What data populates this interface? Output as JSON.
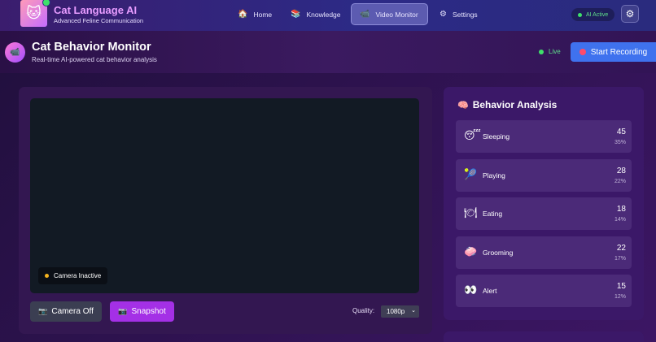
{
  "app": {
    "title": "Cat Language AI",
    "subtitle": "Advanced Feline Communication",
    "logo_icon": "cat-face-icon"
  },
  "nav": {
    "items": [
      {
        "label": "Home",
        "icon": "house-icon",
        "active": false
      },
      {
        "label": "Knowledge",
        "icon": "books-icon",
        "active": false
      },
      {
        "label": "Video Monitor",
        "icon": "video-camera-icon",
        "active": true
      },
      {
        "label": "Settings",
        "icon": "gear-icon",
        "active": false
      }
    ],
    "status_badge": "AI Active"
  },
  "header": {
    "title": "Cat Behavior Monitor",
    "subtitle": "Real-time AI-powered cat behavior analysis",
    "live_label": "Live",
    "record_button": "Start Recording"
  },
  "video": {
    "camera_status": "Camera Inactive",
    "camera_button": "Camera Off",
    "snapshot_button": "Snapshot",
    "quality_label": "Quality:",
    "quality_value": "1080p"
  },
  "behavior": {
    "title": "Behavior Analysis",
    "items": [
      {
        "label": "Sleeping",
        "icon": "sleeping-face-icon",
        "count": "45",
        "percent": "35%"
      },
      {
        "label": "Playing",
        "icon": "yarn-toy-icon",
        "count": "28",
        "percent": "22%"
      },
      {
        "label": "Eating",
        "icon": "plate-utensils-icon",
        "count": "18",
        "percent": "14%"
      },
      {
        "label": "Grooming",
        "icon": "sparkle-bubble-icon",
        "count": "22",
        "percent": "17%"
      },
      {
        "label": "Alert",
        "icon": "eyes-icon",
        "count": "15",
        "percent": "12%"
      }
    ]
  },
  "colors": {
    "accent": "#a430e6",
    "primary_button": "#3f72ee",
    "live_green": "#3ee06a",
    "inactive_dot": "#f5b41f"
  }
}
